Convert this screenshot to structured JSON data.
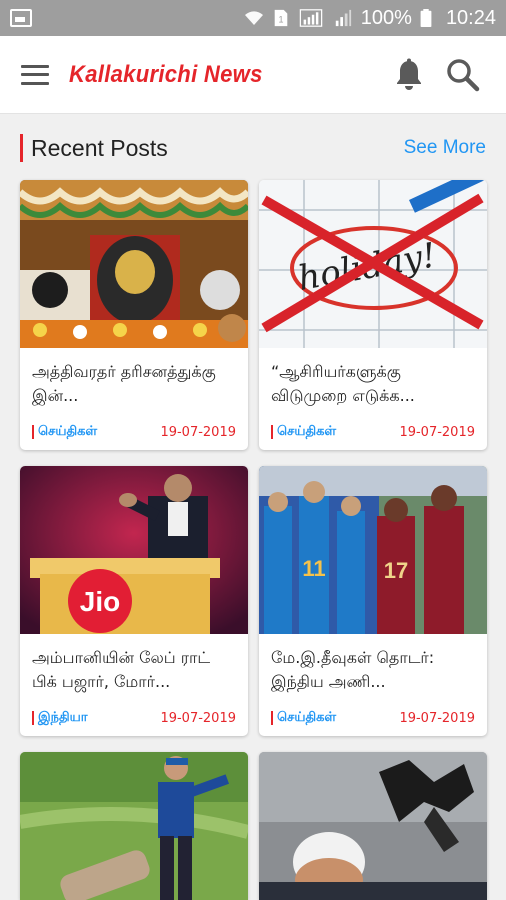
{
  "status_bar": {
    "battery_text": "100%",
    "time": "10:24",
    "icons": [
      "image-icon",
      "wifi-icon",
      "sim1-icon",
      "signal-icon",
      "signal-icon-2",
      "battery-icon"
    ]
  },
  "app_bar": {
    "title": "Kallakurichi News",
    "title_color": "#e5252a",
    "icons": [
      "menu-icon",
      "bell-icon",
      "search-icon"
    ]
  },
  "section": {
    "title": "Recent Posts",
    "see_more": "See More",
    "accent_color": "#e5252a",
    "link_color": "#2196f3"
  },
  "posts": [
    {
      "title": "அத்திவரதர் தரிசனத்துக்கு இன்...",
      "category": "செய்திகள்",
      "date": "19-07-2019"
    },
    {
      "title": "“ஆசிரியர்களுக்கு விடுமுறை எடுக்க...",
      "category": "செய்திகள்",
      "date": "19-07-2019"
    },
    {
      "title": "அம்பானியின் லேப் ராட் பிக் பஜார், மோர்...",
      "category": "இந்தியா",
      "date": "19-07-2019"
    },
    {
      "title": "மே.இ.தீவுகள் தொடர்: இந்திய அணி...",
      "category": "செய்திகள்",
      "date": "19-07-2019"
    },
    {
      "title": "",
      "category": "",
      "date": ""
    },
    {
      "title": "",
      "category": "",
      "date": ""
    }
  ]
}
